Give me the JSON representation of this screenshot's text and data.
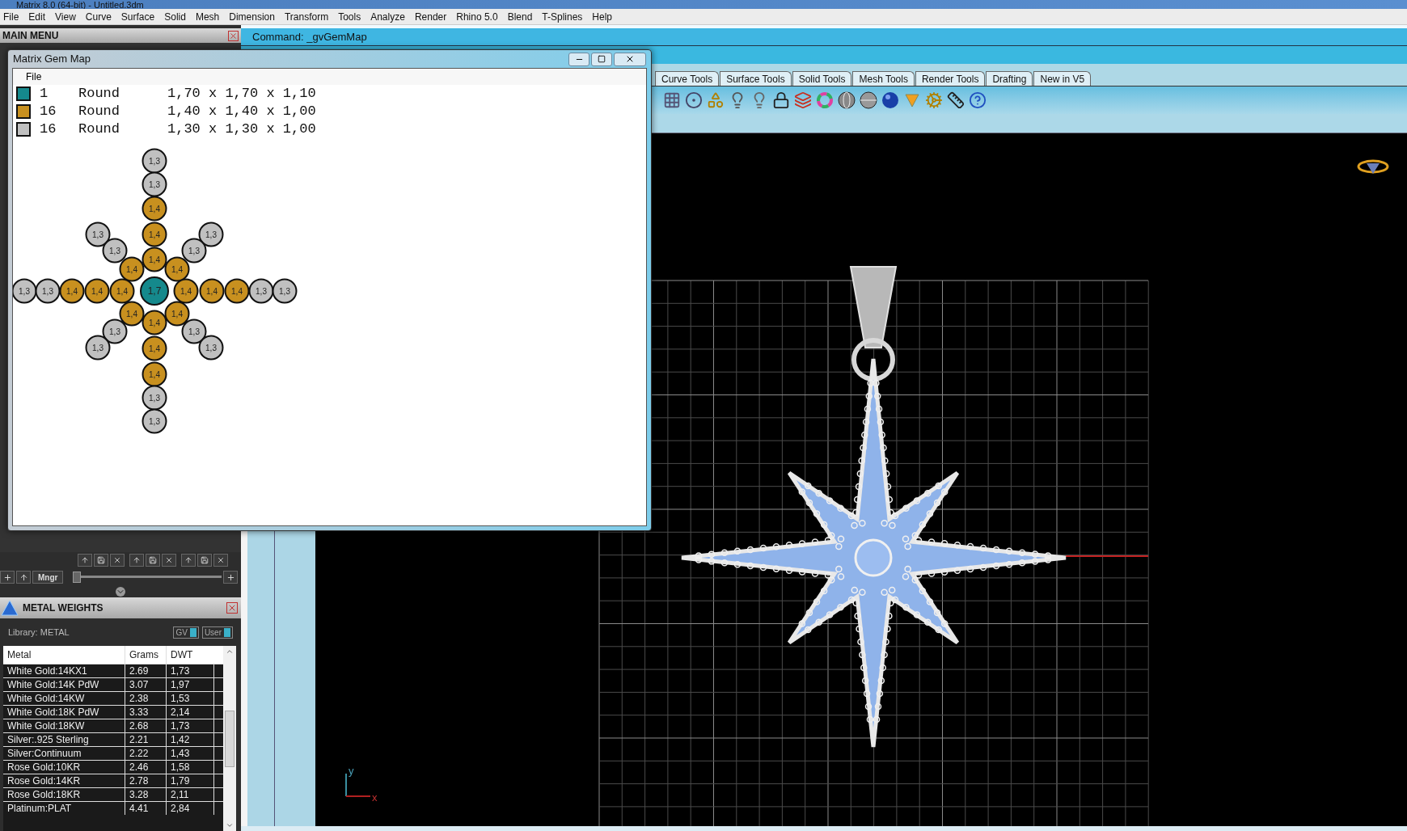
{
  "title_bar": {
    "title": "Matrix 8.0 (64-bit) - Untitled.3dm"
  },
  "menu_bar": [
    "File",
    "Edit",
    "View",
    "Curve",
    "Surface",
    "Solid",
    "Mesh",
    "Dimension",
    "Transform",
    "Tools",
    "Analyze",
    "Render",
    "Rhino 5.0",
    "Blend",
    "T-Splines",
    "Help"
  ],
  "main_menu": {
    "title": "MAIN MENU"
  },
  "panel_controls": {
    "manager_button": "Mngr",
    "slider": {
      "level": 0
    }
  },
  "metal_weights": {
    "title": "METAL WEIGHTS",
    "library": "Library: METAL",
    "toggles": [
      "GV",
      "User"
    ],
    "columns": [
      "Metal",
      "Grams",
      "DWT"
    ],
    "rows": [
      {
        "metal": "White Gold:14KX1",
        "grams": "2.69",
        "dwt": "1,73"
      },
      {
        "metal": "White Gold:14K PdW",
        "grams": "3.07",
        "dwt": "1,97"
      },
      {
        "metal": "White Gold:14KW",
        "grams": "2.38",
        "dwt": "1,53"
      },
      {
        "metal": "White Gold:18K PdW",
        "grams": "3.33",
        "dwt": "2,14"
      },
      {
        "metal": "White Gold:18KW",
        "grams": "2.68",
        "dwt": "1,73"
      },
      {
        "metal": "Silver:.925 Sterling",
        "grams": "2.21",
        "dwt": "1,42"
      },
      {
        "metal": "Silver:Continuum",
        "grams": "2.22",
        "dwt": "1,43"
      },
      {
        "metal": "Rose Gold:10KR",
        "grams": "2.46",
        "dwt": "1,58"
      },
      {
        "metal": "Rose Gold:14KR",
        "grams": "2.78",
        "dwt": "1,79"
      },
      {
        "metal": "Rose Gold:18KR",
        "grams": "3.28",
        "dwt": "2,11"
      },
      {
        "metal": "Platinum:PLAT",
        "grams": "4.41",
        "dwt": "2,84"
      }
    ]
  },
  "command_line": {
    "text": "Command: _gvGemMap"
  },
  "toolbar_tabs": [
    "Curve Tools",
    "Surface Tools",
    "Solid Tools",
    "Mesh Tools",
    "Render Tools",
    "Drafting",
    "New in V5"
  ],
  "viewport": {
    "axis_x": "x",
    "axis_y": "y"
  },
  "gem_map_window": {
    "title": "Matrix Gem Map",
    "menu": [
      "File"
    ],
    "legend": [
      {
        "color": "#15898c",
        "count": "1",
        "shape": "Round",
        "size": "1,70 x 1,70 x 1,10"
      },
      {
        "color": "#c8901f",
        "count": "16",
        "shape": "Round",
        "size": "1,40 x 1,40 x 1,00"
      },
      {
        "color": "#c0c0c0",
        "count": "16",
        "shape": "Round",
        "size": "1,30 x 1,30 x 1,00"
      }
    ],
    "stones": [
      {
        "label": "1,3",
        "color": "#c0c0c0"
      },
      {
        "label": "1,3",
        "color": "#c0c0c0"
      },
      {
        "label": "1,4",
        "color": "#c8901f"
      },
      {
        "label": "1,3",
        "color": "#c0c0c0"
      },
      {
        "label": "1,4",
        "color": "#c8901f"
      },
      {
        "label": "1,3",
        "color": "#c0c0c0"
      },
      {
        "label": "1,3",
        "color": "#c0c0c0"
      },
      {
        "label": "1,3",
        "color": "#c0c0c0"
      },
      {
        "label": "1,4",
        "color": "#c8901f"
      },
      {
        "label": "1,4",
        "color": "#c8901f"
      },
      {
        "label": "1,4",
        "color": "#c8901f"
      },
      {
        "label": "1,3",
        "color": "#c0c0c0"
      },
      {
        "label": "1,3",
        "color": "#c0c0c0"
      },
      {
        "label": "1,4",
        "color": "#c8901f"
      },
      {
        "label": "1,4",
        "color": "#c8901f"
      },
      {
        "label": "1,4",
        "color": "#c8901f"
      },
      {
        "label": "1,7",
        "color": "#15898c"
      },
      {
        "label": "1,4",
        "color": "#c8901f"
      },
      {
        "label": "1,4",
        "color": "#c8901f"
      },
      {
        "label": "1,4",
        "color": "#c8901f"
      },
      {
        "label": "1,3",
        "color": "#c0c0c0"
      },
      {
        "label": "1,3",
        "color": "#c0c0c0"
      },
      {
        "label": "1,4",
        "color": "#c8901f"
      },
      {
        "label": "1,4",
        "color": "#c8901f"
      },
      {
        "label": "1,4",
        "color": "#c8901f"
      },
      {
        "label": "1,3",
        "color": "#c0c0c0"
      },
      {
        "label": "1,3",
        "color": "#c0c0c0"
      },
      {
        "label": "1,3",
        "color": "#c0c0c0"
      },
      {
        "label": "1,4",
        "color": "#c8901f"
      },
      {
        "label": "1,3",
        "color": "#c0c0c0"
      },
      {
        "label": "1,4",
        "color": "#c8901f"
      },
      {
        "label": "1,3",
        "color": "#c0c0c0"
      },
      {
        "label": "1,3",
        "color": "#c0c0c0"
      }
    ]
  }
}
